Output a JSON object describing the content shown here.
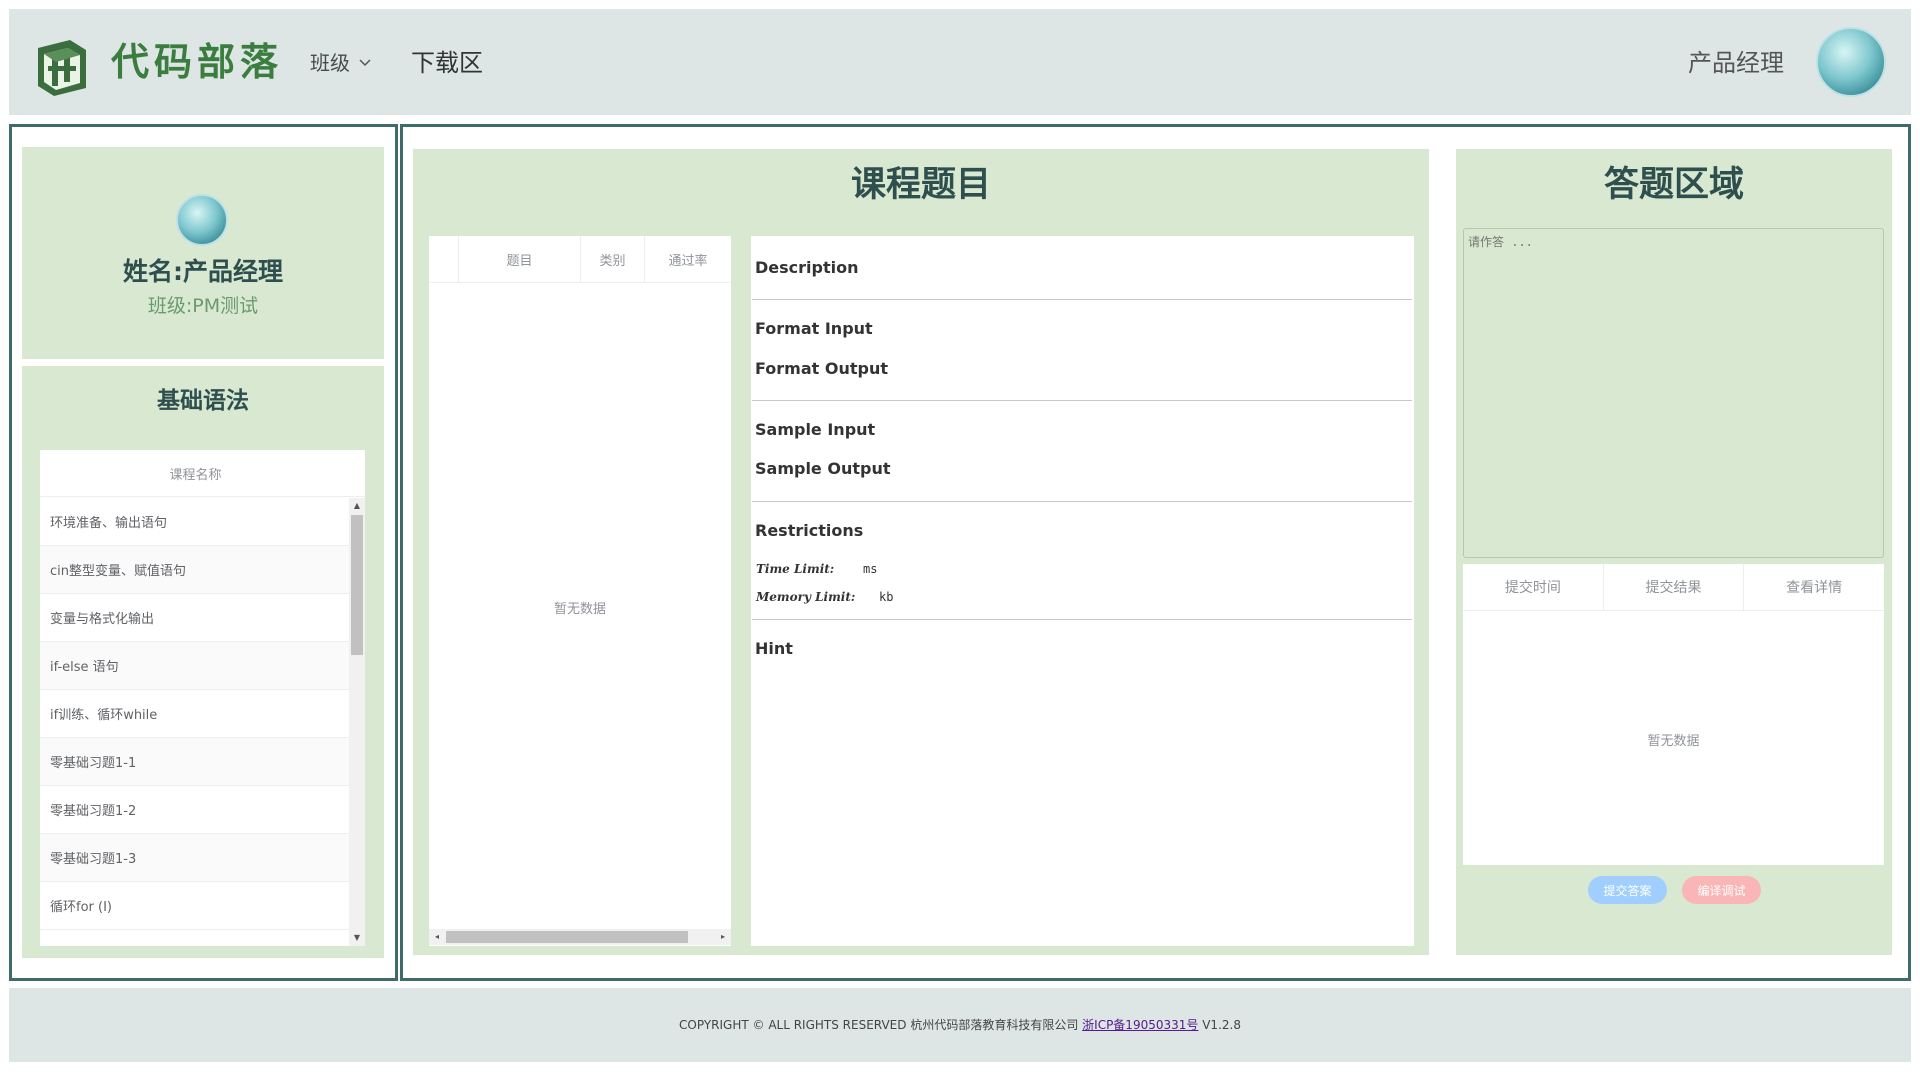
{
  "header": {
    "brand": "代码部落",
    "nav_class": "班级",
    "nav_download": "下载区",
    "user_name": "产品经理"
  },
  "profile": {
    "name": "姓名:产品经理",
    "class": "班级:PM测试"
  },
  "courses": {
    "title": "基础语法",
    "column": "课程名称",
    "items": [
      "环境准备、输出语句",
      "cin整型变量、赋值语句",
      "变量与格式化输出",
      "if-else 语句",
      "if训练、循环while",
      "零基础习题1-1",
      "零基础习题1-2",
      "零基础习题1-3",
      "循环for (I)"
    ]
  },
  "problems": {
    "title": "课程题目",
    "columns": [
      "题目",
      "类别",
      "通过率"
    ],
    "empty": "暂无数据"
  },
  "description": {
    "description": "Description",
    "format_input": "Format Input",
    "format_output": "Format Output",
    "sample_input": "Sample Input",
    "sample_output": "Sample Output",
    "restrictions": "Restrictions",
    "time_limit_label": "Time Limit:",
    "time_limit_unit": "ms",
    "memory_limit_label": "Memory Limit:",
    "memory_limit_unit": "kb",
    "hint": "Hint"
  },
  "answer": {
    "title": "答题区域",
    "placeholder": "请作答 ...",
    "columns": [
      "提交时间",
      "提交结果",
      "查看详情"
    ],
    "empty": "暂无数据",
    "submit_label": "提交答案",
    "debug_label": "编译调试"
  },
  "footer": {
    "copyright": "COPYRIGHT © ALL RIGHTS RESERVED 杭州代码部落教育科技有限公司",
    "icp": "浙ICP备19050331号",
    "version": "V1.2.8"
  },
  "colors": {
    "panel_green": "#d9e9d1",
    "header_bg": "#dde6e4",
    "frame_border": "#3f6b68",
    "brand_green": "#3b7d3f",
    "submit_blue": "#a0cfff",
    "debug_red": "#fab6b6"
  }
}
